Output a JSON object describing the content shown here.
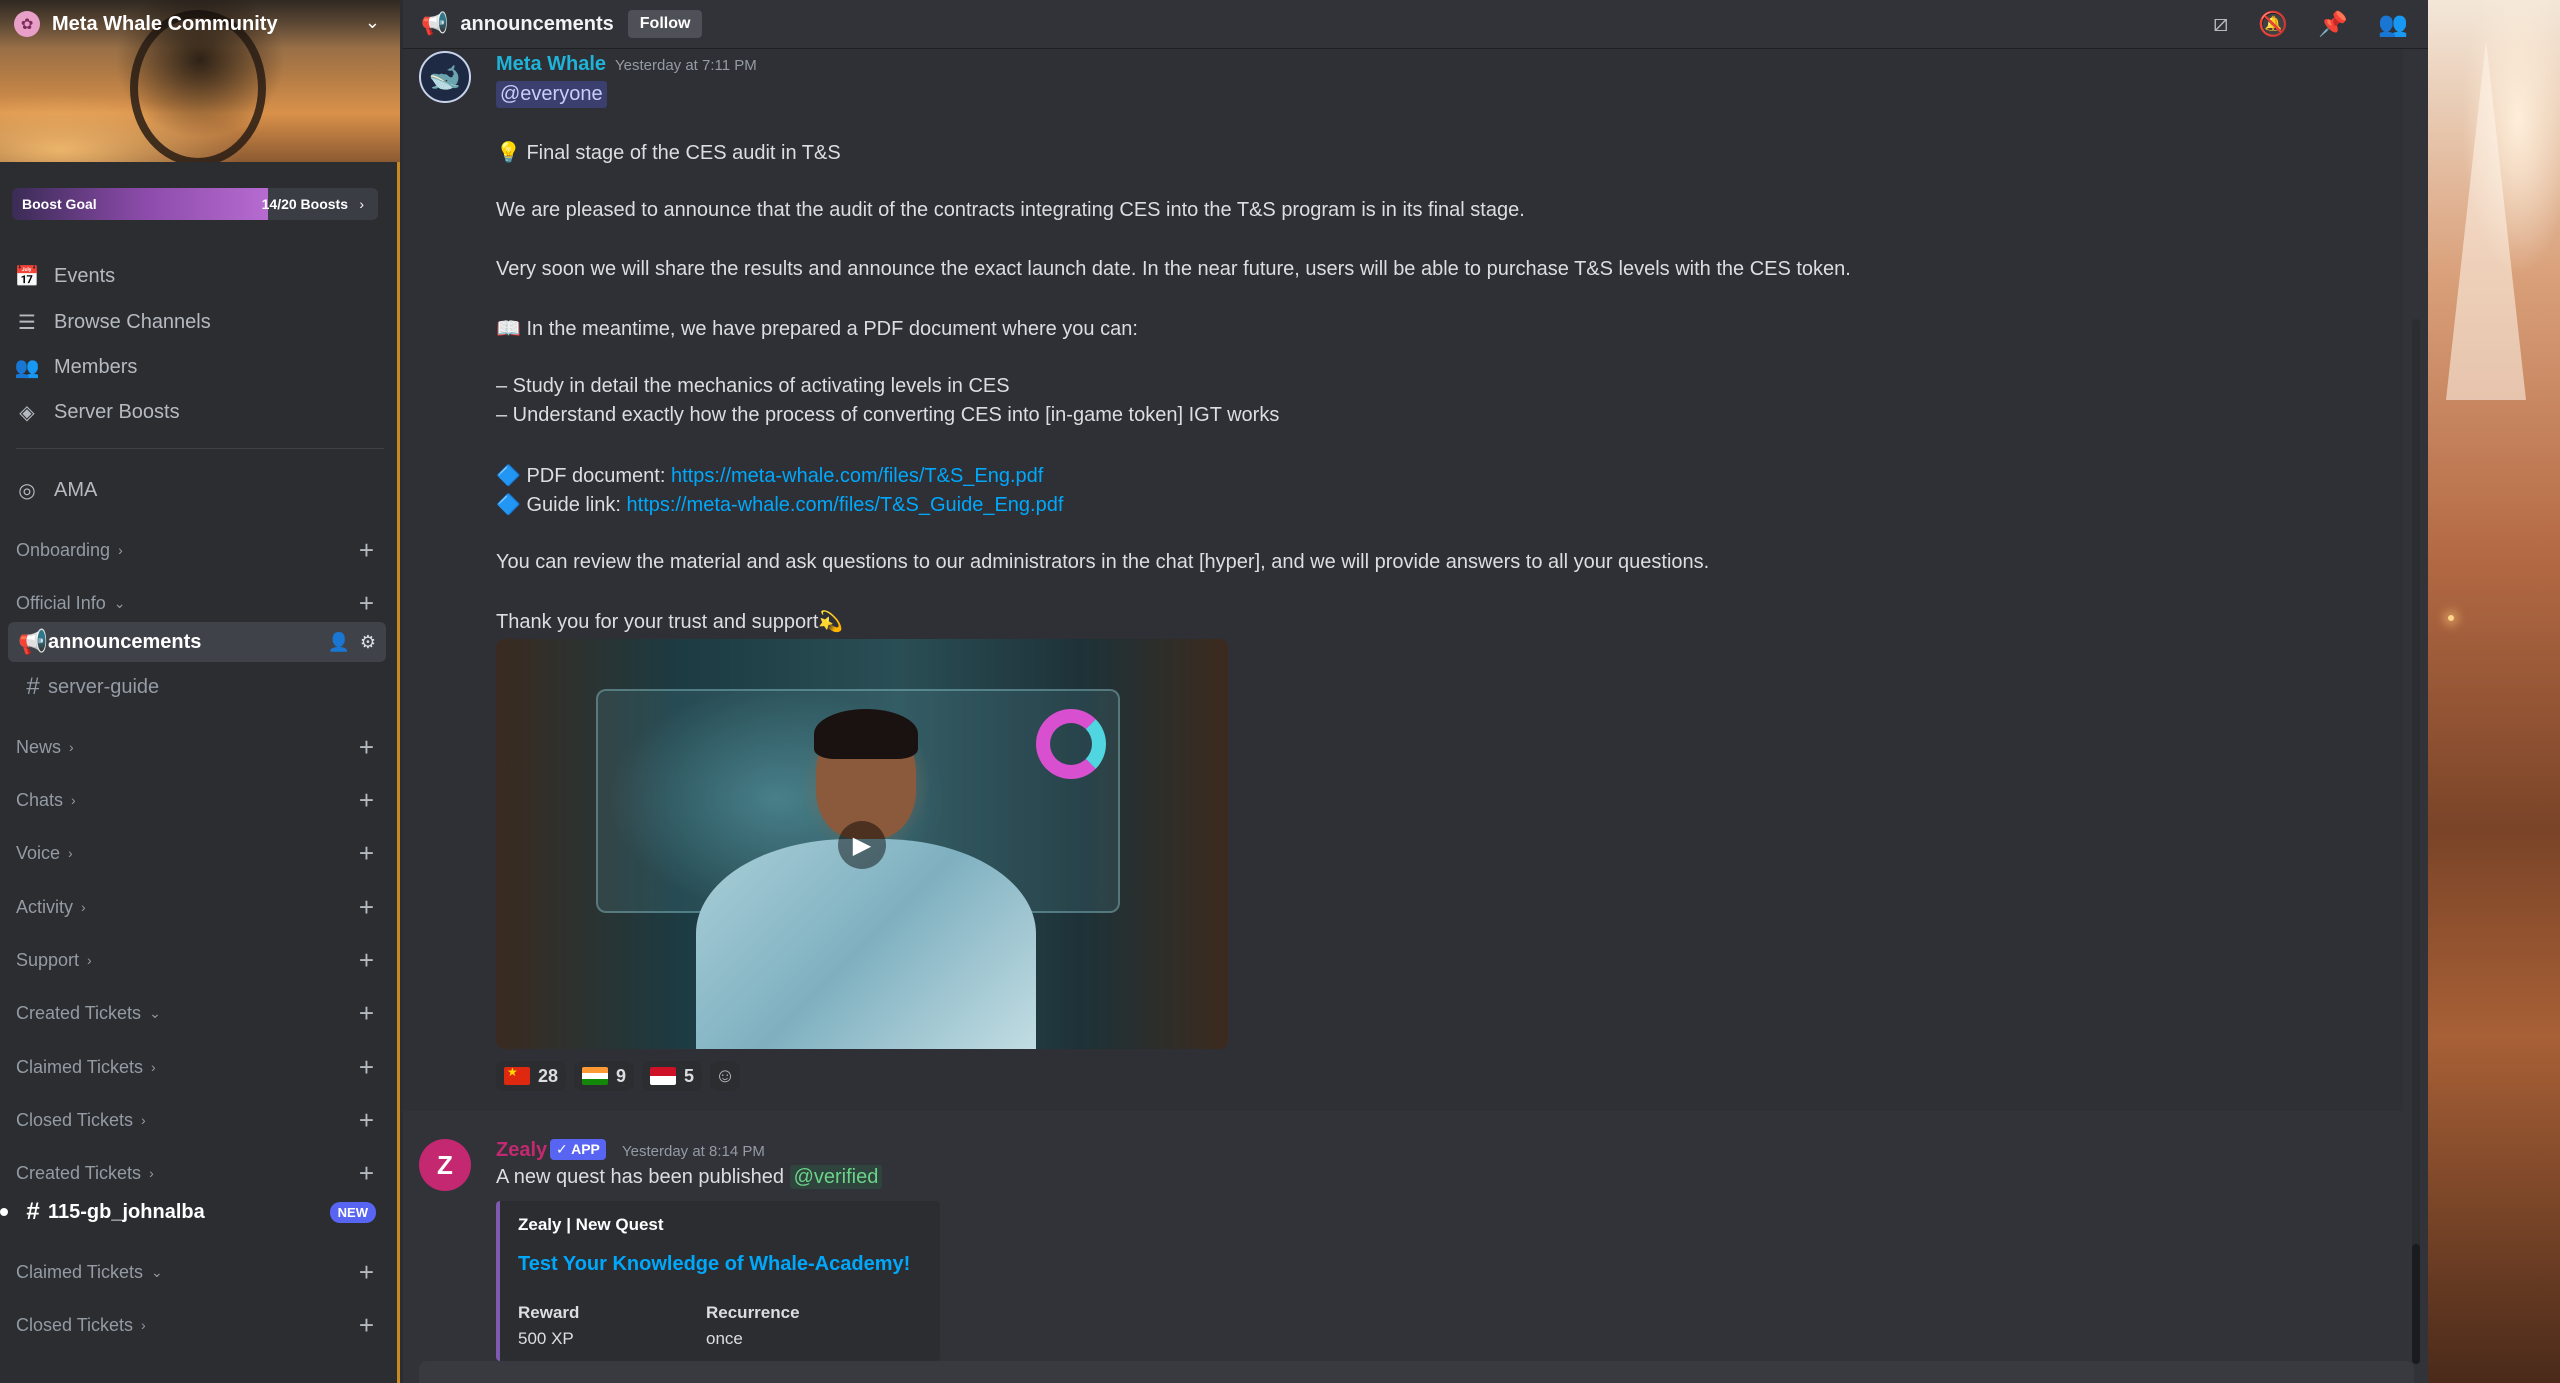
{
  "server": {
    "name": "Meta Whale Community",
    "boost_label": "Boost Goal",
    "boost_count": "14/20 Boosts",
    "boost_progress": 0.7
  },
  "nav": [
    {
      "label": "Events",
      "icon": "calendar-icon"
    },
    {
      "label": "Browse Channels",
      "icon": "browse-channels-icon"
    },
    {
      "label": "Members",
      "icon": "members-icon"
    },
    {
      "label": "Server Boosts",
      "icon": "boost-icon"
    }
  ],
  "stage_channel": {
    "label": "AMA",
    "icon": "stage-icon"
  },
  "categories": {
    "onboarding": "Onboarding",
    "official_info": "Official Info",
    "news": "News",
    "chats": "Chats",
    "voice": "Voice",
    "activity": "Activity",
    "support": "Support",
    "created_tickets_1": "Created Tickets",
    "claimed_tickets_1": "Claimed Tickets",
    "closed_tickets_1": "Closed Tickets",
    "created_tickets_2": "Created Tickets",
    "claimed_tickets_2": "Claimed Tickets",
    "closed_tickets_2": "Closed Tickets"
  },
  "channels": {
    "announcements": "announcements",
    "server_guide": "server-guide",
    "ticket": "115-gb_johnalba",
    "ticket_badge": "NEW"
  },
  "topbar": {
    "channel": "announcements",
    "follow": "Follow"
  },
  "message1": {
    "author": "Meta Whale",
    "author_color": "#1fb3d8",
    "timestamp": "Yesterday at 7:11 PM",
    "mention": "@everyone",
    "line1": "💡 Final stage of the CES audit in T&S",
    "line2": "We are pleased to announce that the audit of the contracts integrating CES into the T&S program is in its final stage.",
    "line3": "Very soon we will share the results and announce the exact launch date. In the near future, users will be able to purchase T&S levels with the CES token.",
    "line4": "📖 In the meantime, we have prepared a PDF document where you can:",
    "line5": "– Study in detail the mechanics of activating levels in CES",
    "line6": "– Understand exactly how the process of converting CES into [in-game token] IGT works",
    "pdf_label": "🔷 PDF document: ",
    "pdf_link": "https://meta-whale.com/files/T&S_Eng.pdf",
    "guide_label": "🔷 Guide link: ",
    "guide_link": "https://meta-whale.com/files/T&S_Guide_Eng.pdf",
    "line7": "You can review the material and ask questions to our administrators in the chat [hyper], and we will provide answers to all your questions.",
    "line8": "Thank you for your trust and support💫",
    "reactions": [
      {
        "flag": "cn",
        "count": "28"
      },
      {
        "flag": "in",
        "count": "9"
      },
      {
        "flag": "id",
        "count": "5"
      }
    ]
  },
  "message2": {
    "author": "Zealy",
    "author_color": "#c42870",
    "app_badge": "✓ APP",
    "timestamp": "Yesterday at 8:14 PM",
    "text": "A new quest has been published ",
    "mention": "@verified",
    "embed": {
      "provider": "Zealy | New Quest",
      "title": "Test Your Knowledge of Whale-Academy!",
      "reward_label": "Reward",
      "reward_value": "500 XP",
      "recurrence_label": "Recurrence",
      "recurrence_value": "once"
    }
  }
}
